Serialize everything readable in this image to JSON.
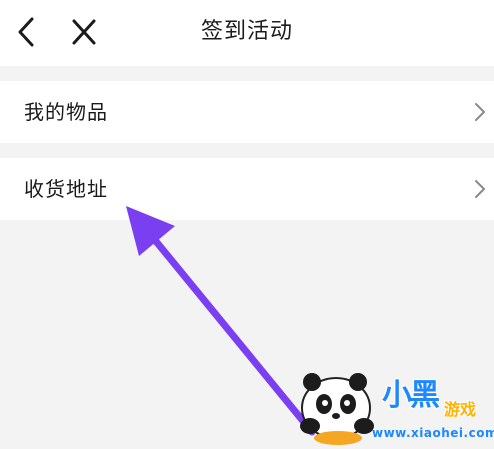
{
  "header": {
    "title": "签到活动",
    "back_icon": "chevron-left-icon",
    "close_icon": "close-icon"
  },
  "menu": {
    "items": [
      {
        "label": "我的物品",
        "icon": "chevron-right-icon"
      },
      {
        "label": "收货地址",
        "icon": "chevron-right-icon"
      }
    ]
  },
  "annotation": {
    "arrow_color": "#7b3ff2"
  },
  "watermark": {
    "brand": "小黑",
    "brand_suffix": "游戏",
    "url": "www.xiaohei.com"
  },
  "colors": {
    "background": "#f3f3f3",
    "surface": "#ffffff",
    "text": "#1a1a1a",
    "chevron": "#8a8a8a"
  }
}
